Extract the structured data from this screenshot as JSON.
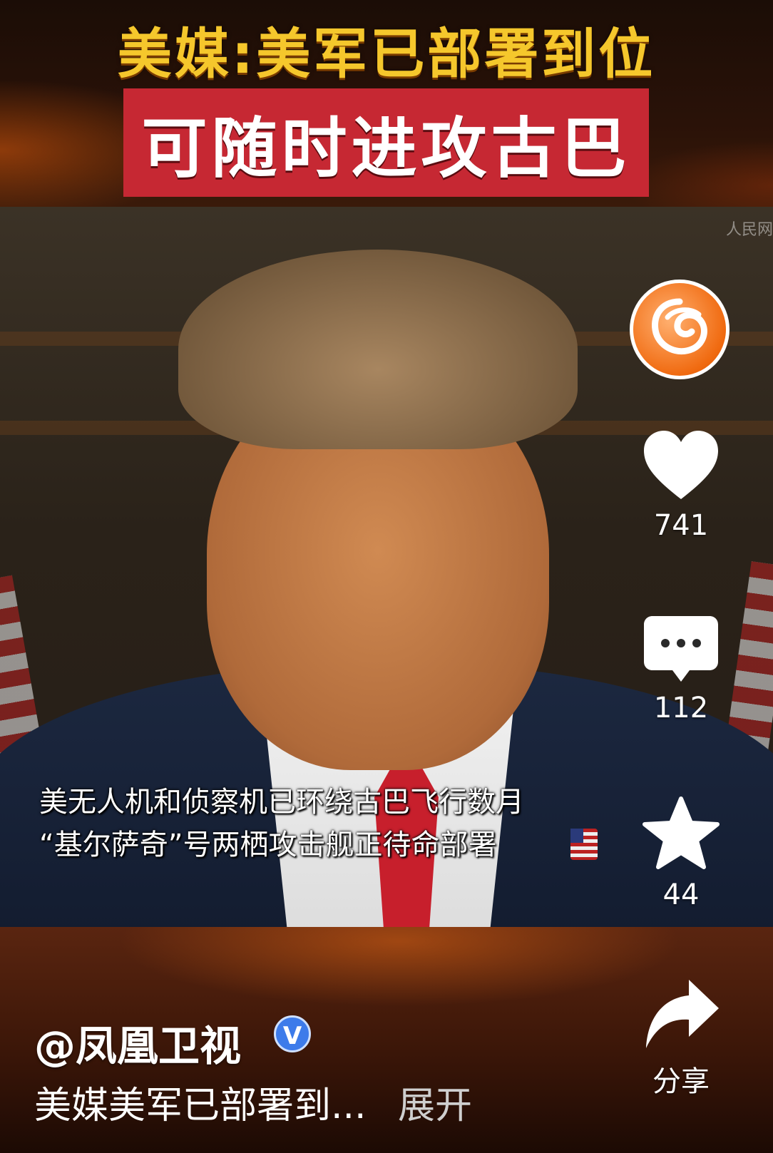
{
  "banner": {
    "headline": "美媒:美军已部署到位",
    "subhead": "可随时进攻古巴"
  },
  "video": {
    "caption_line1": "美无人机和侦察机已环绕古巴飞行数月",
    "caption_line2": "“基尔萨奇”号两栖攻击舰正待命部署",
    "watermark": "人民网"
  },
  "rail": {
    "likes": "741",
    "comments": "112",
    "favorites": "44",
    "share_label": "分享"
  },
  "post": {
    "account": "@凤凰卫视",
    "verified_mark": "V",
    "description": "美媒美军已部署到...",
    "expand_label": "展开"
  },
  "colors": {
    "headline_yellow": "#f5c72c",
    "subhead_red": "#c62833",
    "verified_blue": "#3d7bea",
    "logo_orange": "#f06a10"
  },
  "icons": [
    "phoenix-logo-icon",
    "heart-icon",
    "comment-icon",
    "star-icon",
    "share-icon",
    "verified-icon",
    "us-flag-icon"
  ]
}
